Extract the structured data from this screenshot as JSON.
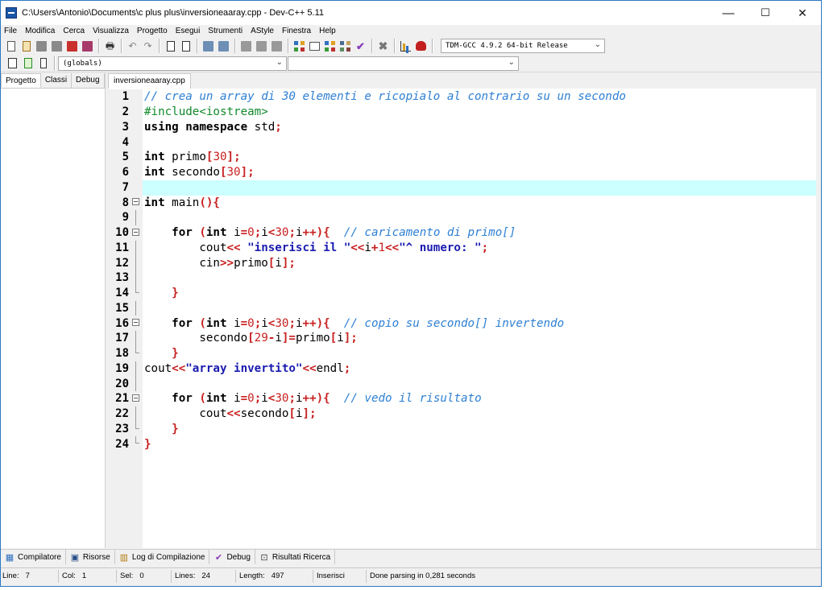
{
  "window": {
    "title": "C:\\Users\\Antonio\\Documents\\c plus plus\\inversioneaaray.cpp - Dev-C++ 5.11",
    "minimize": "—",
    "maximize": "☐",
    "close": "✕"
  },
  "menu": [
    "File",
    "Modifica",
    "Cerca",
    "Visualizza",
    "Progetto",
    "Esegui",
    "Strumenti",
    "AStyle",
    "Finestra",
    "Help"
  ],
  "toolbar": {
    "compiler": "TDM-GCC 4.9.2 64-bit Release",
    "globals_combo": "(globals)",
    "function_combo": ""
  },
  "left_panel": {
    "tabs": [
      "Progetto",
      "Classi",
      "Debug"
    ]
  },
  "editor": {
    "tab": "inversioneaaray.cpp",
    "lines": [
      {
        "n": "1",
        "fold": "",
        "tokens": [
          {
            "t": "// crea un array di 30 elementi e ricopialo al contrario su un secondo",
            "c": "comment"
          }
        ]
      },
      {
        "n": "2",
        "fold": "",
        "tokens": [
          {
            "t": "#include<iostream>",
            "c": "pre"
          }
        ]
      },
      {
        "n": "3",
        "fold": "",
        "tokens": [
          {
            "t": "using namespace ",
            "c": "kw"
          },
          {
            "t": "std",
            "c": "id"
          },
          {
            "t": ";",
            "c": "sym"
          }
        ]
      },
      {
        "n": "4",
        "fold": "",
        "tokens": []
      },
      {
        "n": "5",
        "fold": "",
        "tokens": [
          {
            "t": "int ",
            "c": "kw"
          },
          {
            "t": "primo",
            "c": "id"
          },
          {
            "t": "[",
            "c": "sym"
          },
          {
            "t": "30",
            "c": "num"
          },
          {
            "t": "];",
            "c": "sym"
          }
        ]
      },
      {
        "n": "6",
        "fold": "",
        "tokens": [
          {
            "t": "int ",
            "c": "kw"
          },
          {
            "t": "secondo",
            "c": "id"
          },
          {
            "t": "[",
            "c": "sym"
          },
          {
            "t": "30",
            "c": "num"
          },
          {
            "t": "];",
            "c": "sym"
          }
        ]
      },
      {
        "n": "7",
        "fold": "",
        "tokens": []
      },
      {
        "n": "8",
        "fold": "open",
        "tokens": [
          {
            "t": "int ",
            "c": "kw"
          },
          {
            "t": "main",
            "c": "id"
          },
          {
            "t": "(){",
            "c": "sym"
          }
        ]
      },
      {
        "n": "9",
        "fold": "line",
        "tokens": []
      },
      {
        "n": "10",
        "fold": "open",
        "tokens": [
          {
            "t": "    for ",
            "c": "kw"
          },
          {
            "t": "(",
            "c": "sym"
          },
          {
            "t": "int ",
            "c": "kw"
          },
          {
            "t": "i",
            "c": "id"
          },
          {
            "t": "=",
            "c": "sym"
          },
          {
            "t": "0",
            "c": "num"
          },
          {
            "t": ";",
            "c": "sym"
          },
          {
            "t": "i",
            "c": "id"
          },
          {
            "t": "<",
            "c": "sym"
          },
          {
            "t": "30",
            "c": "num"
          },
          {
            "t": ";",
            "c": "sym"
          },
          {
            "t": "i",
            "c": "id"
          },
          {
            "t": "++){  ",
            "c": "sym"
          },
          {
            "t": "// caricamento di primo[]",
            "c": "comment"
          }
        ]
      },
      {
        "n": "11",
        "fold": "line",
        "tokens": [
          {
            "t": "        cout",
            "c": "id"
          },
          {
            "t": "<< ",
            "c": "sym"
          },
          {
            "t": "\"inserisci il \"",
            "c": "str"
          },
          {
            "t": "<<",
            "c": "sym"
          },
          {
            "t": "i",
            "c": "id"
          },
          {
            "t": "+",
            "c": "sym"
          },
          {
            "t": "1",
            "c": "num"
          },
          {
            "t": "<<",
            "c": "sym"
          },
          {
            "t": "\"^ numero: \"",
            "c": "str"
          },
          {
            "t": ";",
            "c": "sym"
          }
        ]
      },
      {
        "n": "12",
        "fold": "line",
        "tokens": [
          {
            "t": "        cin",
            "c": "id"
          },
          {
            "t": ">>",
            "c": "sym"
          },
          {
            "t": "primo",
            "c": "id"
          },
          {
            "t": "[",
            "c": "sym"
          },
          {
            "t": "i",
            "c": "id"
          },
          {
            "t": "];",
            "c": "sym"
          }
        ]
      },
      {
        "n": "13",
        "fold": "line",
        "tokens": []
      },
      {
        "n": "14",
        "fold": "end",
        "tokens": [
          {
            "t": "    }",
            "c": "sym"
          }
        ]
      },
      {
        "n": "15",
        "fold": "line",
        "tokens": []
      },
      {
        "n": "16",
        "fold": "open",
        "tokens": [
          {
            "t": "    for ",
            "c": "kw"
          },
          {
            "t": "(",
            "c": "sym"
          },
          {
            "t": "int ",
            "c": "kw"
          },
          {
            "t": "i",
            "c": "id"
          },
          {
            "t": "=",
            "c": "sym"
          },
          {
            "t": "0",
            "c": "num"
          },
          {
            "t": ";",
            "c": "sym"
          },
          {
            "t": "i",
            "c": "id"
          },
          {
            "t": "<",
            "c": "sym"
          },
          {
            "t": "30",
            "c": "num"
          },
          {
            "t": ";",
            "c": "sym"
          },
          {
            "t": "i",
            "c": "id"
          },
          {
            "t": "++){  ",
            "c": "sym"
          },
          {
            "t": "// copio su secondo[] invertendo",
            "c": "comment"
          }
        ]
      },
      {
        "n": "17",
        "fold": "line",
        "tokens": [
          {
            "t": "        secondo",
            "c": "id"
          },
          {
            "t": "[",
            "c": "sym"
          },
          {
            "t": "29",
            "c": "num"
          },
          {
            "t": "-",
            "c": "sym"
          },
          {
            "t": "i",
            "c": "id"
          },
          {
            "t": "]=",
            "c": "sym"
          },
          {
            "t": "primo",
            "c": "id"
          },
          {
            "t": "[",
            "c": "sym"
          },
          {
            "t": "i",
            "c": "id"
          },
          {
            "t": "];",
            "c": "sym"
          }
        ]
      },
      {
        "n": "18",
        "fold": "end",
        "tokens": [
          {
            "t": "    }",
            "c": "sym"
          }
        ]
      },
      {
        "n": "19",
        "fold": "line",
        "tokens": [
          {
            "t": "cout",
            "c": "id"
          },
          {
            "t": "<<",
            "c": "sym"
          },
          {
            "t": "\"array invertito\"",
            "c": "str"
          },
          {
            "t": "<<",
            "c": "sym"
          },
          {
            "t": "endl",
            "c": "id"
          },
          {
            "t": ";",
            "c": "sym"
          }
        ]
      },
      {
        "n": "20",
        "fold": "line",
        "tokens": []
      },
      {
        "n": "21",
        "fold": "open",
        "tokens": [
          {
            "t": "    for ",
            "c": "kw"
          },
          {
            "t": "(",
            "c": "sym"
          },
          {
            "t": "int ",
            "c": "kw"
          },
          {
            "t": "i",
            "c": "id"
          },
          {
            "t": "=",
            "c": "sym"
          },
          {
            "t": "0",
            "c": "num"
          },
          {
            "t": ";",
            "c": "sym"
          },
          {
            "t": "i",
            "c": "id"
          },
          {
            "t": "<",
            "c": "sym"
          },
          {
            "t": "30",
            "c": "num"
          },
          {
            "t": ";",
            "c": "sym"
          },
          {
            "t": "i",
            "c": "id"
          },
          {
            "t": "++){  ",
            "c": "sym"
          },
          {
            "t": "// vedo il risultato",
            "c": "comment"
          }
        ]
      },
      {
        "n": "22",
        "fold": "line",
        "tokens": [
          {
            "t": "        cout",
            "c": "id"
          },
          {
            "t": "<<",
            "c": "sym"
          },
          {
            "t": "secondo",
            "c": "id"
          },
          {
            "t": "[",
            "c": "sym"
          },
          {
            "t": "i",
            "c": "id"
          },
          {
            "t": "];",
            "c": "sym"
          }
        ]
      },
      {
        "n": "23",
        "fold": "end",
        "tokens": [
          {
            "t": "    }",
            "c": "sym"
          }
        ]
      },
      {
        "n": "24",
        "fold": "end",
        "tokens": [
          {
            "t": "}",
            "c": "sym"
          }
        ]
      }
    ],
    "highlighted_line": "7"
  },
  "bottom_tabs": [
    {
      "label": "Compilatore",
      "icon": "grid-icon"
    },
    {
      "label": "Risorse",
      "icon": "resources-icon"
    },
    {
      "label": "Log di Compilazione",
      "icon": "chart-icon"
    },
    {
      "label": "Debug",
      "icon": "check-icon"
    },
    {
      "label": "Risultati Ricerca",
      "icon": "search-results-icon"
    }
  ],
  "status": {
    "line_label": "Line:",
    "line_value": "7",
    "col_label": "Col:",
    "col_value": "1",
    "sel_label": "Sel:",
    "sel_value": "0",
    "lines_label": "Lines:",
    "lines_value": "24",
    "length_label": "Length:",
    "length_value": "497",
    "mode": "Inserisci",
    "message": "Done parsing in 0,281 seconds"
  }
}
